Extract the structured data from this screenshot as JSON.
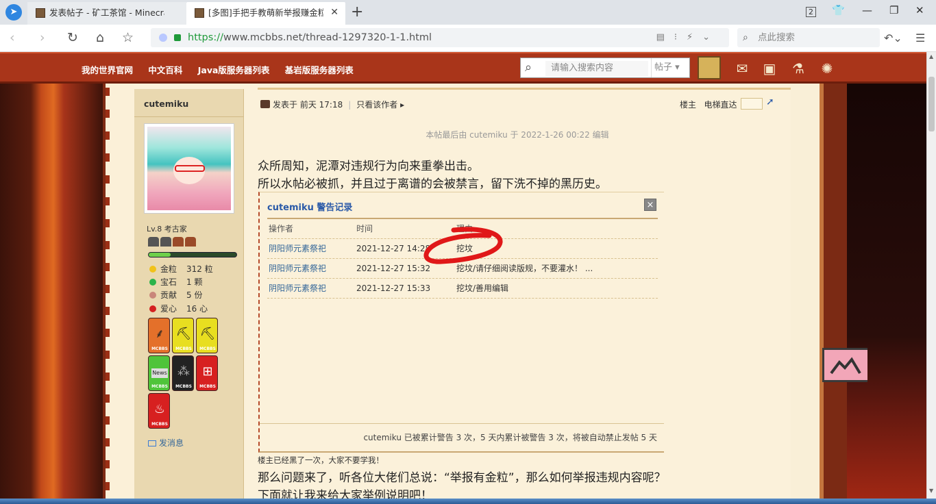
{
  "browser": {
    "tabs": [
      {
        "title": "发表帖子 - 矿工茶馆 - Minecraft",
        "active": false
      },
      {
        "title": "[多图]手把手教萌新举报赚金粒",
        "active": true
      }
    ],
    "tab_count_badge": "2",
    "url_https": "https://",
    "url_rest": "www.mcbbs.net/thread-1297320-1-1.html",
    "search_placeholder": "点此搜索"
  },
  "site_header": {
    "nav": [
      "我的世界官网",
      "中文百科",
      "Java版服务器列表",
      "基岩版服务器列表"
    ],
    "search_placeholder": "请输入搜索内容",
    "search_scope": "帖子"
  },
  "author": {
    "name": "cutemiku",
    "level": "Lv.8 考古家",
    "xp_fraction": 0.25,
    "stats": [
      {
        "label": "金粒",
        "value": "312 粒",
        "color": "#f1c21a"
      },
      {
        "label": "宝石",
        "value": "1 颗",
        "color": "#2bb34a"
      },
      {
        "label": "贡献",
        "value": "5 份",
        "color": "#c9867a"
      },
      {
        "label": "爱心",
        "value": "16 心",
        "color": "#d42020"
      }
    ],
    "badge_tag": "MCBBS",
    "badge_news": "News",
    "send_message": "发消息"
  },
  "post": {
    "posted_at": "发表于 前天 17:18",
    "only_author": "只看该作者",
    "floor_label": "楼主",
    "elevator_label": "电梯直达",
    "edit_note": "本帖最后由 cutemiku 于 2022-1-26 00:22 编辑",
    "line1": "众所周知，泥潭对违规行为向来重拳出击。",
    "line2": "所以水帖必被抓，并且过于离谱的会被禁言，留下洗不掉的黑历史。",
    "small_note": "楼主已经黑了一次，大家不要学我！",
    "line3": "那么问题来了，听各位大佬们总说：“举报有金粒”，那么如何举报违规内容呢？",
    "line4": "下面就让我来给大家举例说明吧！"
  },
  "warning_dialog": {
    "title": "cutemiku 警告记录",
    "close": "×",
    "headers": [
      "操作者",
      "时间",
      "理由"
    ],
    "rows": [
      {
        "operator": "阴阳师元素祭祀",
        "time": "2021-12-27 14:28",
        "reason": "挖坟"
      },
      {
        "operator": "阴阳师元素祭祀",
        "time": "2021-12-27 15:32",
        "reason": "挖坟/请仔细阅读版规，不要灌水！ ..."
      },
      {
        "operator": "阴阳师元素祭祀",
        "time": "2021-12-27 15:33",
        "reason": "挖坟/善用编辑"
      }
    ],
    "footer": "cutemiku 已被累计警告 3 次，5 天内累计被警告 3 次，将被自动禁止发帖 5 天"
  }
}
